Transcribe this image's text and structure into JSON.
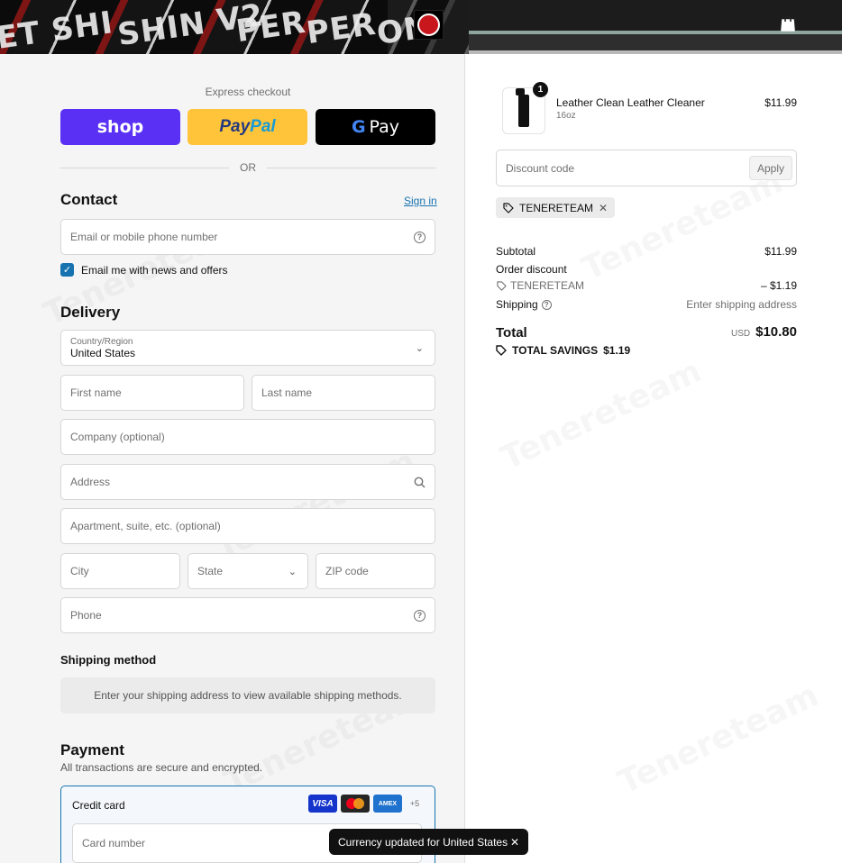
{
  "header": {
    "banner_words": [
      "ET SHI",
      "SHIN V2",
      "PER",
      "PER",
      "ON"
    ],
    "logo_icon": "store-logo-icon",
    "cart_icon": "shopping-bag-icon"
  },
  "express": {
    "title": "Express checkout",
    "shop_label": "shop",
    "paypal_label_1": "Pay",
    "paypal_label_2": "Pal",
    "gpay_g": "G",
    "gpay_label": "Pay",
    "or_label": "OR"
  },
  "contact": {
    "heading": "Contact",
    "signin": "Sign in",
    "email_placeholder": "Email or mobile phone number",
    "newsletter_label": "Email me with news and offers",
    "newsletter_checked": true
  },
  "delivery": {
    "heading": "Delivery",
    "country_caption": "Country/Region",
    "country_value": "United States",
    "first_name": "First name",
    "last_name": "Last name",
    "company": "Company (optional)",
    "address": "Address",
    "apartment": "Apartment, suite, etc. (optional)",
    "city": "City",
    "state": "State",
    "zip": "ZIP code",
    "phone": "Phone"
  },
  "shipping": {
    "heading": "Shipping method",
    "note": "Enter your shipping address to view available shipping methods."
  },
  "payment": {
    "heading": "Payment",
    "subtitle": "All transactions are secure and encrypted.",
    "method_label": "Credit card",
    "card_brands": [
      "VISA",
      "",
      "AMEX"
    ],
    "more_cards": "+5",
    "card_number_placeholder": "Card number"
  },
  "order": {
    "item": {
      "name": "Leather Clean Leather Cleaner",
      "variant": "16oz",
      "price": "$11.99",
      "quantity": "1"
    },
    "discount_placeholder": "Discount code",
    "apply_label": "Apply",
    "applied_code": "TENERETEAM",
    "subtotal_label": "Subtotal",
    "subtotal_value": "$11.99",
    "order_discount_label": "Order discount",
    "discount_code_label": "TENERETEAM",
    "discount_value": "– $1.19",
    "shipping_label": "Shipping",
    "shipping_value": "Enter shipping address",
    "total_label": "Total",
    "currency": "USD",
    "total_value": "$10.80",
    "savings_label": "TOTAL SAVINGS",
    "savings_value": "$1.19"
  },
  "toast": {
    "message": "Currency updated for United States",
    "close": "✕"
  },
  "watermark": "Tenereteam",
  "colors": {
    "shop": "#5a31f4",
    "paypal": "#ffc439",
    "link": "#1773b0"
  }
}
